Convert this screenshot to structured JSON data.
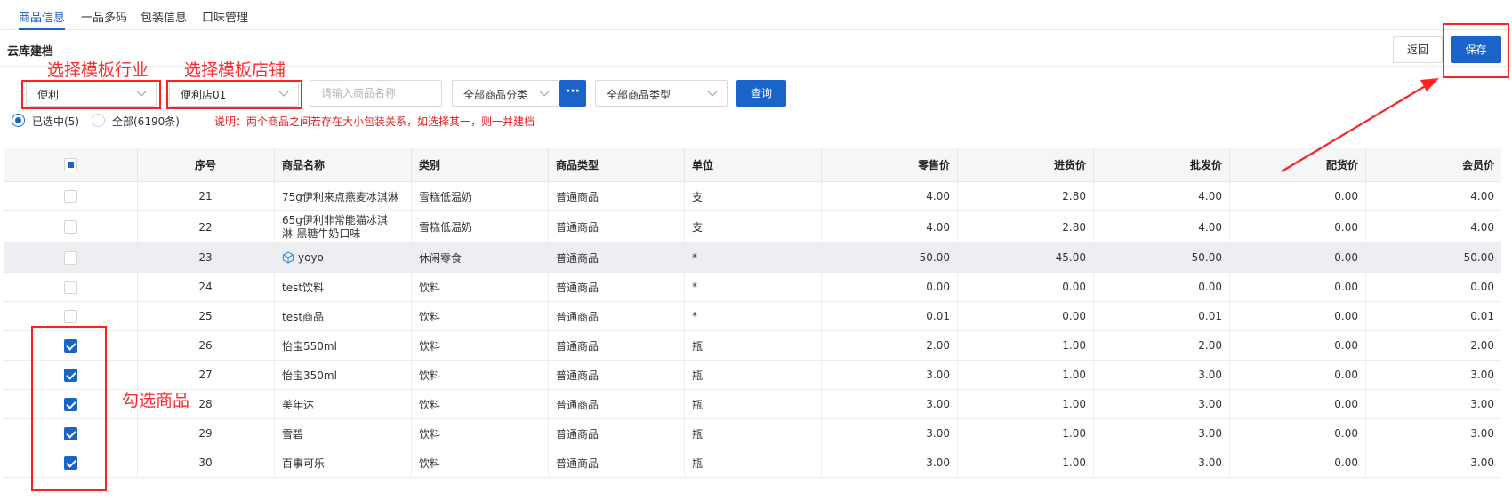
{
  "tabs": [
    {
      "label": "商品信息"
    },
    {
      "label": "一品多码"
    },
    {
      "label": "包装信息"
    },
    {
      "label": "口味管理"
    }
  ],
  "header": {
    "title": "云库建档",
    "back_label": "返回",
    "save_label": "保存"
  },
  "filters": {
    "industry": "便利",
    "store": "便利店01",
    "name_placeholder": "请输入商品名称",
    "category": "全部商品分类",
    "dots": "···",
    "type": "全部商品类型",
    "query_label": "查询"
  },
  "radios": {
    "selected": "已选中(5)",
    "all": "全部(6190条)"
  },
  "note": "说明：两个商品之间若存在大小包装关系，如选择其一，则一并建档",
  "table": {
    "headers": {
      "seq": "序号",
      "name": "商品名称",
      "category": "类别",
      "type": "商品类型",
      "unit": "单位",
      "retail": "零售价",
      "purchase": "进货价",
      "wholesale": "批发价",
      "distribution": "配货价",
      "member": "会员价"
    },
    "rows": [
      {
        "seq": "21",
        "name": "75g伊利来点燕麦冰淇淋",
        "category": "雪糕低温奶",
        "type": "普通商品",
        "unit": "支",
        "retail": "4.00",
        "purchase": "2.80",
        "wholesale": "4.00",
        "distribution": "0.00",
        "member": "4.00",
        "checked": false
      },
      {
        "seq": "22",
        "name": "65g伊利非常能猫冰淇淋-黑糖牛奶口味",
        "category": "雪糕低温奶",
        "type": "普通商品",
        "unit": "支",
        "retail": "4.00",
        "purchase": "2.80",
        "wholesale": "4.00",
        "distribution": "0.00",
        "member": "4.00",
        "checked": false
      },
      {
        "seq": "23",
        "name": "yoyo",
        "category": "休闲零食",
        "type": "普通商品",
        "unit": "*",
        "retail": "50.00",
        "purchase": "45.00",
        "wholesale": "50.00",
        "distribution": "0.00",
        "member": "50.00",
        "checked": false
      },
      {
        "seq": "24",
        "name": "test饮料",
        "category": "饮料",
        "type": "普通商品",
        "unit": "*",
        "retail": "0.00",
        "purchase": "0.00",
        "wholesale": "0.00",
        "distribution": "0.00",
        "member": "0.00",
        "checked": false
      },
      {
        "seq": "25",
        "name": "test商品",
        "category": "饮料",
        "type": "普通商品",
        "unit": "*",
        "retail": "0.01",
        "purchase": "0.00",
        "wholesale": "0.01",
        "distribution": "0.00",
        "member": "0.01",
        "checked": false
      },
      {
        "seq": "26",
        "name": "怡宝550ml",
        "category": "饮料",
        "type": "普通商品",
        "unit": "瓶",
        "retail": "2.00",
        "purchase": "1.00",
        "wholesale": "2.00",
        "distribution": "0.00",
        "member": "2.00",
        "checked": true
      },
      {
        "seq": "27",
        "name": "怡宝350ml",
        "category": "饮料",
        "type": "普通商品",
        "unit": "瓶",
        "retail": "3.00",
        "purchase": "1.00",
        "wholesale": "3.00",
        "distribution": "0.00",
        "member": "3.00",
        "checked": true
      },
      {
        "seq": "28",
        "name": "美年达",
        "category": "饮料",
        "type": "普通商品",
        "unit": "瓶",
        "retail": "3.00",
        "purchase": "1.00",
        "wholesale": "3.00",
        "distribution": "0.00",
        "member": "3.00",
        "checked": true
      },
      {
        "seq": "29",
        "name": "雪碧",
        "category": "饮料",
        "type": "普通商品",
        "unit": "瓶",
        "retail": "3.00",
        "purchase": "1.00",
        "wholesale": "3.00",
        "distribution": "0.00",
        "member": "3.00",
        "checked": true
      },
      {
        "seq": "30",
        "name": "百事可乐",
        "category": "饮料",
        "type": "普通商品",
        "unit": "瓶",
        "retail": "3.00",
        "purchase": "1.00",
        "wholesale": "3.00",
        "distribution": "0.00",
        "member": "3.00",
        "checked": true
      }
    ]
  },
  "annotations": {
    "industry": "选择模板行业",
    "store": "选择模板店铺",
    "check": "勾选商品"
  },
  "colors": {
    "accent": "#1a63c9",
    "annotation": "#ff2020",
    "note": "#e02020"
  },
  "icons": {
    "row23_name": "cube-icon"
  }
}
